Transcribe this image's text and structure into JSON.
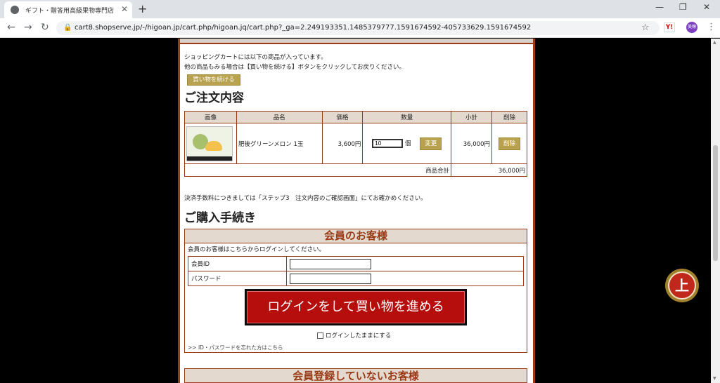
{
  "browser": {
    "tab_title": "ギフト・贈答用高級果物専門店「肥後",
    "url": "cart8.shopserve.jp/-/higoan.jp/cart.php/higoan.jq/cart.php?_ga=2.249193351.1485379777.1591674592-405733629.1591674592",
    "avatar_label": "美穂",
    "ext_label": "Y!"
  },
  "intro": {
    "line1": "ショッピングカートには以下の商品が入っています。",
    "line2": "他の商品もみる場合は【買い物を続ける】ボタンをクリックしてお戻りください。",
    "continue_button": "買い物を続ける"
  },
  "order": {
    "heading": "ご注文内容",
    "columns": [
      "画像",
      "品名",
      "価格",
      "数量",
      "小計",
      "削除"
    ],
    "item": {
      "name": "肥後グリーンメロン 1玉",
      "price": "3,600円",
      "quantity": "10",
      "unit": "個",
      "change_button": "変更",
      "subtotal": "36,000円",
      "delete_button": "削除"
    },
    "total_label": "商品合計",
    "total_value": "36,000円"
  },
  "fee_note": "決済手数料につきましては「ステップ3　注文内容のご確認画面」にてお確かめください。",
  "purchase": {
    "heading": "ご購入手続き",
    "member_title": "会員のお客様",
    "member_desc": "会員のお客様はこちらからログインしてください。",
    "id_label": "会員ID",
    "password_label": "パスワード",
    "login_button": "ログインをして買い物を進める",
    "keep_login": "ログインしたままにする",
    "forgot": ">> ID・パスワードを忘れた方はこちら",
    "nonmember_title": "会員登録していないお客様"
  },
  "to_top": "上"
}
